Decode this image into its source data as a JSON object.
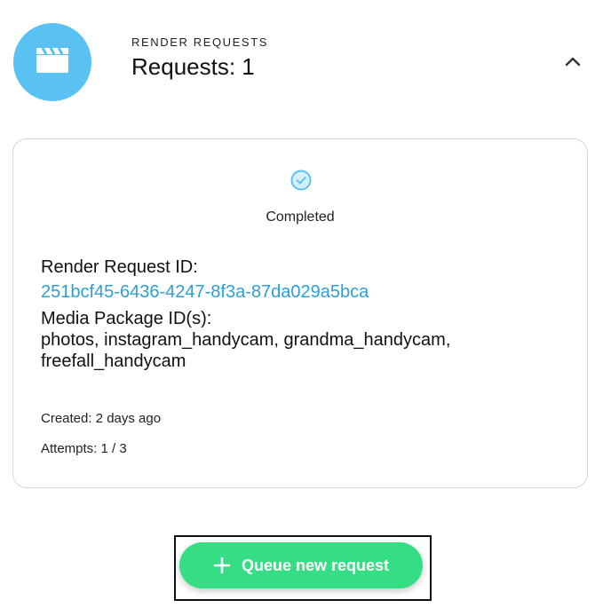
{
  "header": {
    "section_label": "RENDER REQUESTS",
    "title": "Requests: 1",
    "avatar_icon": "clapperboard-icon",
    "collapse_icon": "chevron-up-icon"
  },
  "request": {
    "status_icon": "check-circle-icon",
    "status": "Completed",
    "render_request_id_label": "Render Request ID:",
    "render_request_id": "251bcf45-6436-4247-8f3a-87da029a5bca",
    "media_package_label": "Media Package ID(s):",
    "media_packages_line1": "photos, instagram_handycam, grandma_handycam,",
    "media_packages_line2": "freefall_handycam",
    "created": "Created: 2 days ago",
    "attempts": "Attempts: 1 / 3"
  },
  "actions": {
    "queue_label": "Queue new request",
    "queue_icon": "plus-icon"
  },
  "colors": {
    "avatar": "#5ac2f2",
    "link": "#2aa0d8",
    "primary_button": "#35de84",
    "status_check": "#5ac2f2"
  }
}
